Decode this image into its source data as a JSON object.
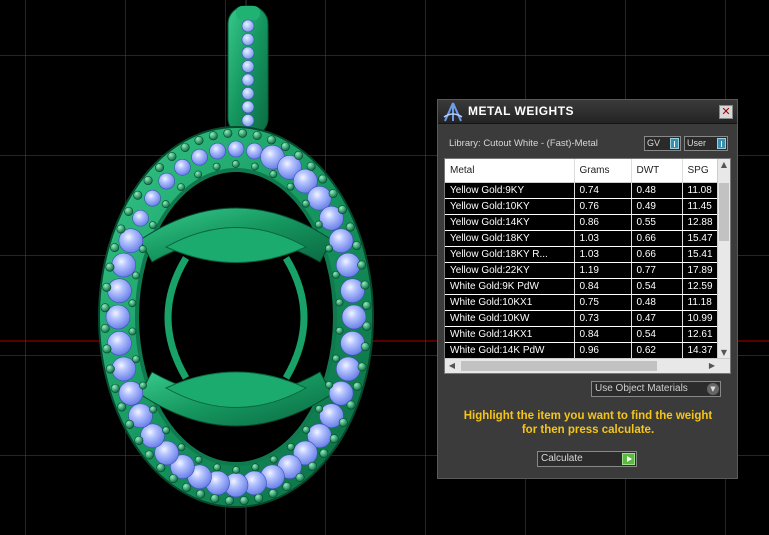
{
  "panel": {
    "title": "METAL WEIGHTS",
    "close_glyph": "✕",
    "library_label": "Library: Cutout White - (Fast)-Metal",
    "toggle_gv": "GV",
    "toggle_user": "User",
    "materials_dropdown": "Use Object Materials",
    "instruction_line1": "Highlight the item you want to find the weight",
    "instruction_line2": "for then press calculate.",
    "calculate_label": "Calculate"
  },
  "table": {
    "headers": [
      "Metal",
      "Grams",
      "DWT",
      "SPG"
    ],
    "rows": [
      [
        "Yellow Gold:9KY",
        "0.74",
        "0.48",
        "11.08"
      ],
      [
        "Yellow Gold:10KY",
        "0.76",
        "0.49",
        "11.45"
      ],
      [
        "Yellow Gold:14KY",
        "0.86",
        "0.55",
        "12.88"
      ],
      [
        "Yellow Gold:18KY",
        "1.03",
        "0.66",
        "15.47"
      ],
      [
        "Yellow Gold:18KY R...",
        "1.03",
        "0.66",
        "15.41"
      ],
      [
        "Yellow Gold:22KY",
        "1.19",
        "0.77",
        "17.89"
      ],
      [
        "White Gold:9K PdW",
        "0.84",
        "0.54",
        "12.59"
      ],
      [
        "White Gold:10KX1",
        "0.75",
        "0.48",
        "11.18"
      ],
      [
        "White Gold:10KW",
        "0.73",
        "0.47",
        "10.99"
      ],
      [
        "White Gold:14KX1",
        "0.84",
        "0.54",
        "12.61"
      ],
      [
        "White Gold:14K PdW",
        "0.96",
        "0.62",
        "14.37"
      ]
    ]
  },
  "icons": {
    "app_logo": "tripod-logo-icon",
    "close": "close-icon",
    "scroll_up": "chevron-up-icon",
    "scroll_down": "chevron-down-icon",
    "scroll_left": "chevron-left-icon",
    "scroll_right": "chevron-right-icon",
    "play": "play-icon"
  },
  "colors": {
    "instruction": "#f5c518",
    "metal_green": "#16a46a",
    "stone_blue": "#8fa6ff",
    "grid_red": "#cc0000",
    "play_green": "#5bb843"
  }
}
